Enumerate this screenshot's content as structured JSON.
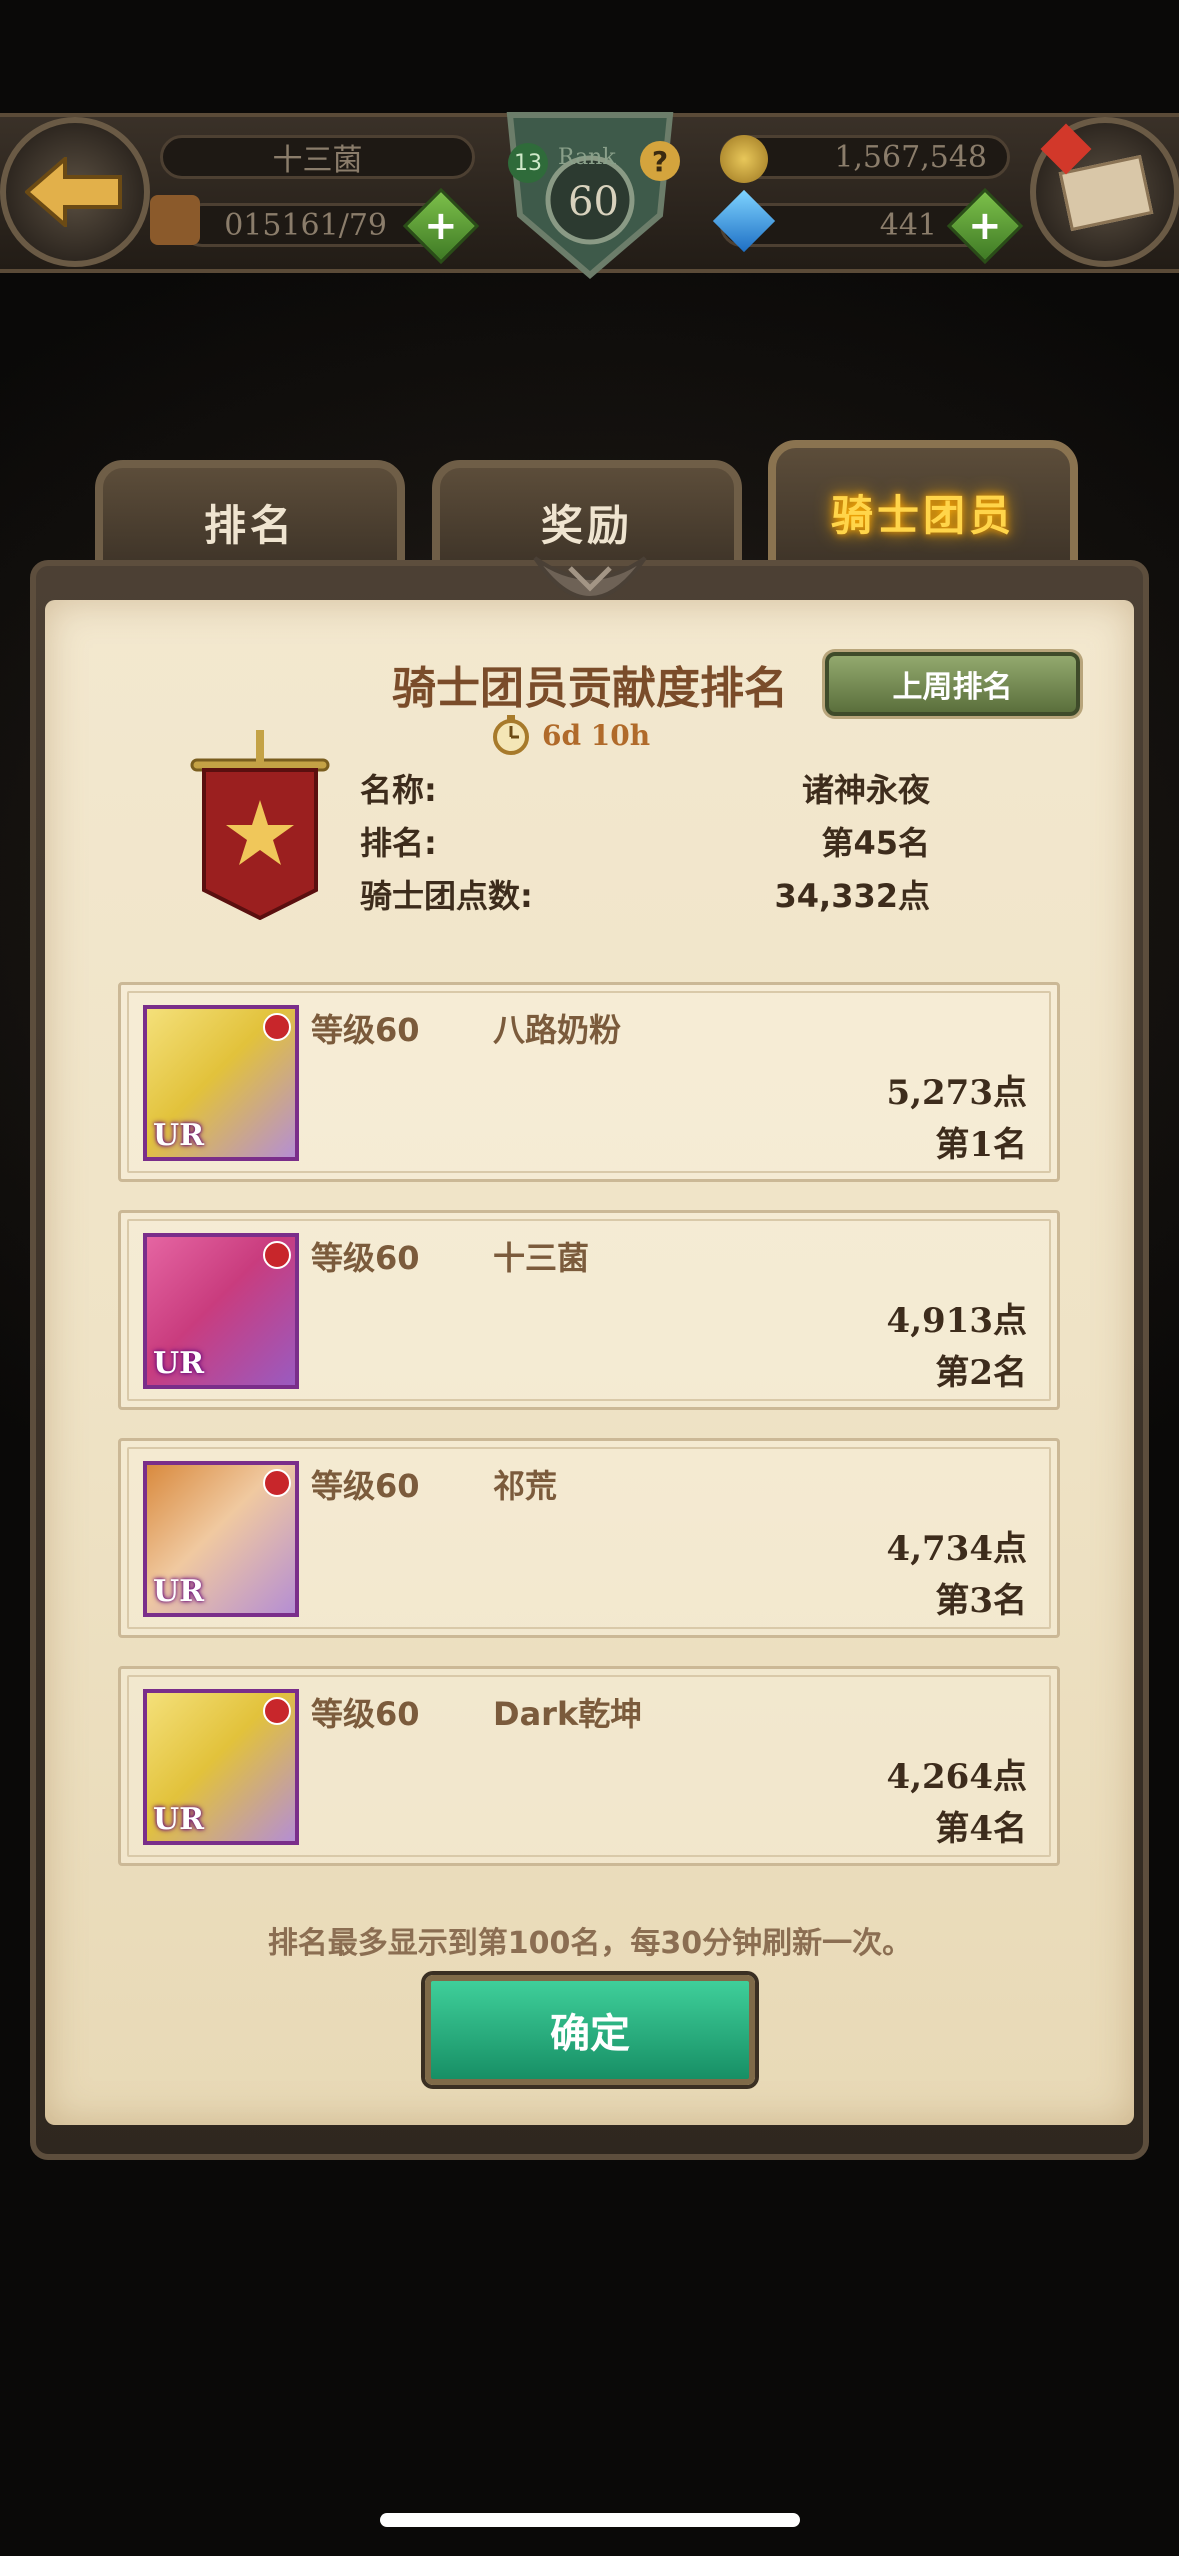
{
  "hud": {
    "player_name": "十三菌",
    "stamina": "015161/79",
    "rank_label": "Rank",
    "rank_level": "60",
    "badge_level": "13",
    "gold": "1,567,548",
    "gems": "441"
  },
  "tabs": [
    {
      "label": "排名"
    },
    {
      "label": "奖励"
    },
    {
      "label": "骑士团员"
    }
  ],
  "panel": {
    "title": "骑士团员贡献度排名",
    "last_week_button": "上周排名",
    "timer": "6d 10h"
  },
  "guild": {
    "name_label": "名称:",
    "name_value": "诸神永夜",
    "rank_label": "排名:",
    "rank_value": "第45名",
    "points_label": "骑士团点数:",
    "points_value": "34,332点"
  },
  "members": [
    {
      "level": "等级60",
      "name": "八路奶粉",
      "points": "5,273点",
      "rank": "第1名",
      "avatar": "meliodas-avatar",
      "rarity": "UR"
    },
    {
      "level": "等级60",
      "name": "十三菌",
      "points": "4,913点",
      "rank": "第2名",
      "avatar": "gowther-avatar",
      "rarity": "UR"
    },
    {
      "level": "等级60",
      "name": "祁荒",
      "points": "4,734点",
      "rank": "第3名",
      "avatar": "escanor-avatar",
      "rarity": "UR"
    },
    {
      "level": "等级60",
      "name": "Dark乾坤",
      "points": "4,264点",
      "rank": "第4名",
      "avatar": "meliodas-avatar",
      "rarity": "UR"
    }
  ],
  "footer": {
    "note": "排名最多显示到第100名，每30分钟刷新一次。",
    "confirm_button": "确定"
  },
  "colors": {
    "active_tab": "#ffd54a",
    "confirm": "#2fb682",
    "last_week": "#6f8a4a"
  }
}
